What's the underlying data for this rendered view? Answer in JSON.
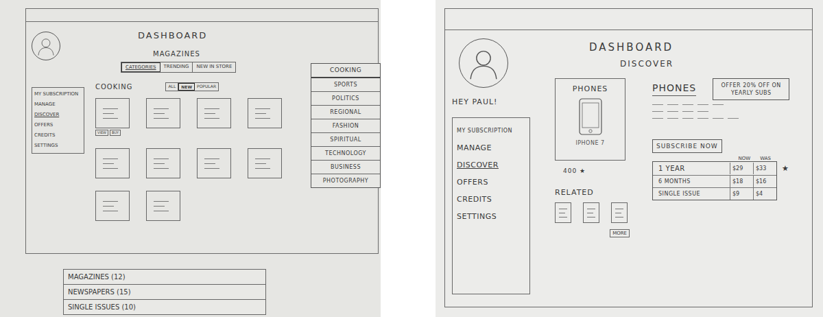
{
  "left": {
    "title": "DASHBOARD",
    "subtitle": "MAGAZINES",
    "tabs": [
      {
        "label": "CATEGORIES",
        "selected": true
      },
      {
        "label": "TRENDING",
        "selected": false
      },
      {
        "label": "NEW IN STORE",
        "selected": false
      }
    ],
    "sidebar": [
      {
        "label": "MY SUBSCRIPTION",
        "selected": false
      },
      {
        "label": "MANAGE",
        "selected": false
      },
      {
        "label": "DISCOVER",
        "selected": true
      },
      {
        "label": "OFFERS",
        "selected": false
      },
      {
        "label": "CREDITS",
        "selected": false
      },
      {
        "label": "SETTINGS",
        "selected": false
      }
    ],
    "section": "COOKING",
    "filters": [
      {
        "label": "ALL",
        "selected": false
      },
      {
        "label": "NEW",
        "selected": true
      },
      {
        "label": "POPULAR",
        "selected": false
      }
    ],
    "card_actions": [
      "VIEW",
      "BUY"
    ],
    "dropdown": [
      {
        "label": "COOKING",
        "selected": true
      },
      {
        "label": "SPORTS",
        "selected": false
      },
      {
        "label": "POLITICS",
        "selected": false
      },
      {
        "label": "REGIONAL",
        "selected": false
      },
      {
        "label": "FASHION",
        "selected": false
      },
      {
        "label": "SPIRITUAL",
        "selected": false
      },
      {
        "label": "TECHNOLOGY",
        "selected": false
      },
      {
        "label": "BUSINESS",
        "selected": false
      },
      {
        "label": "PHOTOGRAPHY",
        "selected": false
      }
    ],
    "counts": [
      "MAGAZINES (12)",
      "NEWSPAPERS (15)",
      "SINGLE ISSUES (10)"
    ]
  },
  "right": {
    "title": "DASHBOARD",
    "subtitle": "DISCOVER",
    "greeting": "HEY PAUL!",
    "sidebar": [
      {
        "label": "MY SUBSCRIPTION",
        "selected": false
      },
      {
        "label": "MANAGE",
        "selected": false
      },
      {
        "label": "DISCOVER",
        "selected": true
      },
      {
        "label": "OFFERS",
        "selected": false
      },
      {
        "label": "CREDITS",
        "selected": false
      },
      {
        "label": "SETTINGS",
        "selected": false
      }
    ],
    "product": {
      "category": "PHONES",
      "name": "IPHONE 7",
      "rating": "400 ★"
    },
    "related": {
      "label": "RELATED",
      "more": "MORE"
    },
    "heading": "PHONES",
    "offer": "OFFER 20% OFF ON YEARLY SUBS",
    "subscribe": "SUBSCRIBE NOW",
    "plans": {
      "columns": [
        "NOW",
        "WAS"
      ],
      "mark": "★",
      "rows": [
        {
          "name": "1 YEAR",
          "now": "$29",
          "was": "$33",
          "recommended": true
        },
        {
          "name": "6 MONTHS",
          "now": "$18",
          "was": "$16",
          "recommended": false
        },
        {
          "name": "SINGLE ISSUE",
          "now": "$9",
          "was": "$4",
          "recommended": false
        }
      ]
    }
  }
}
